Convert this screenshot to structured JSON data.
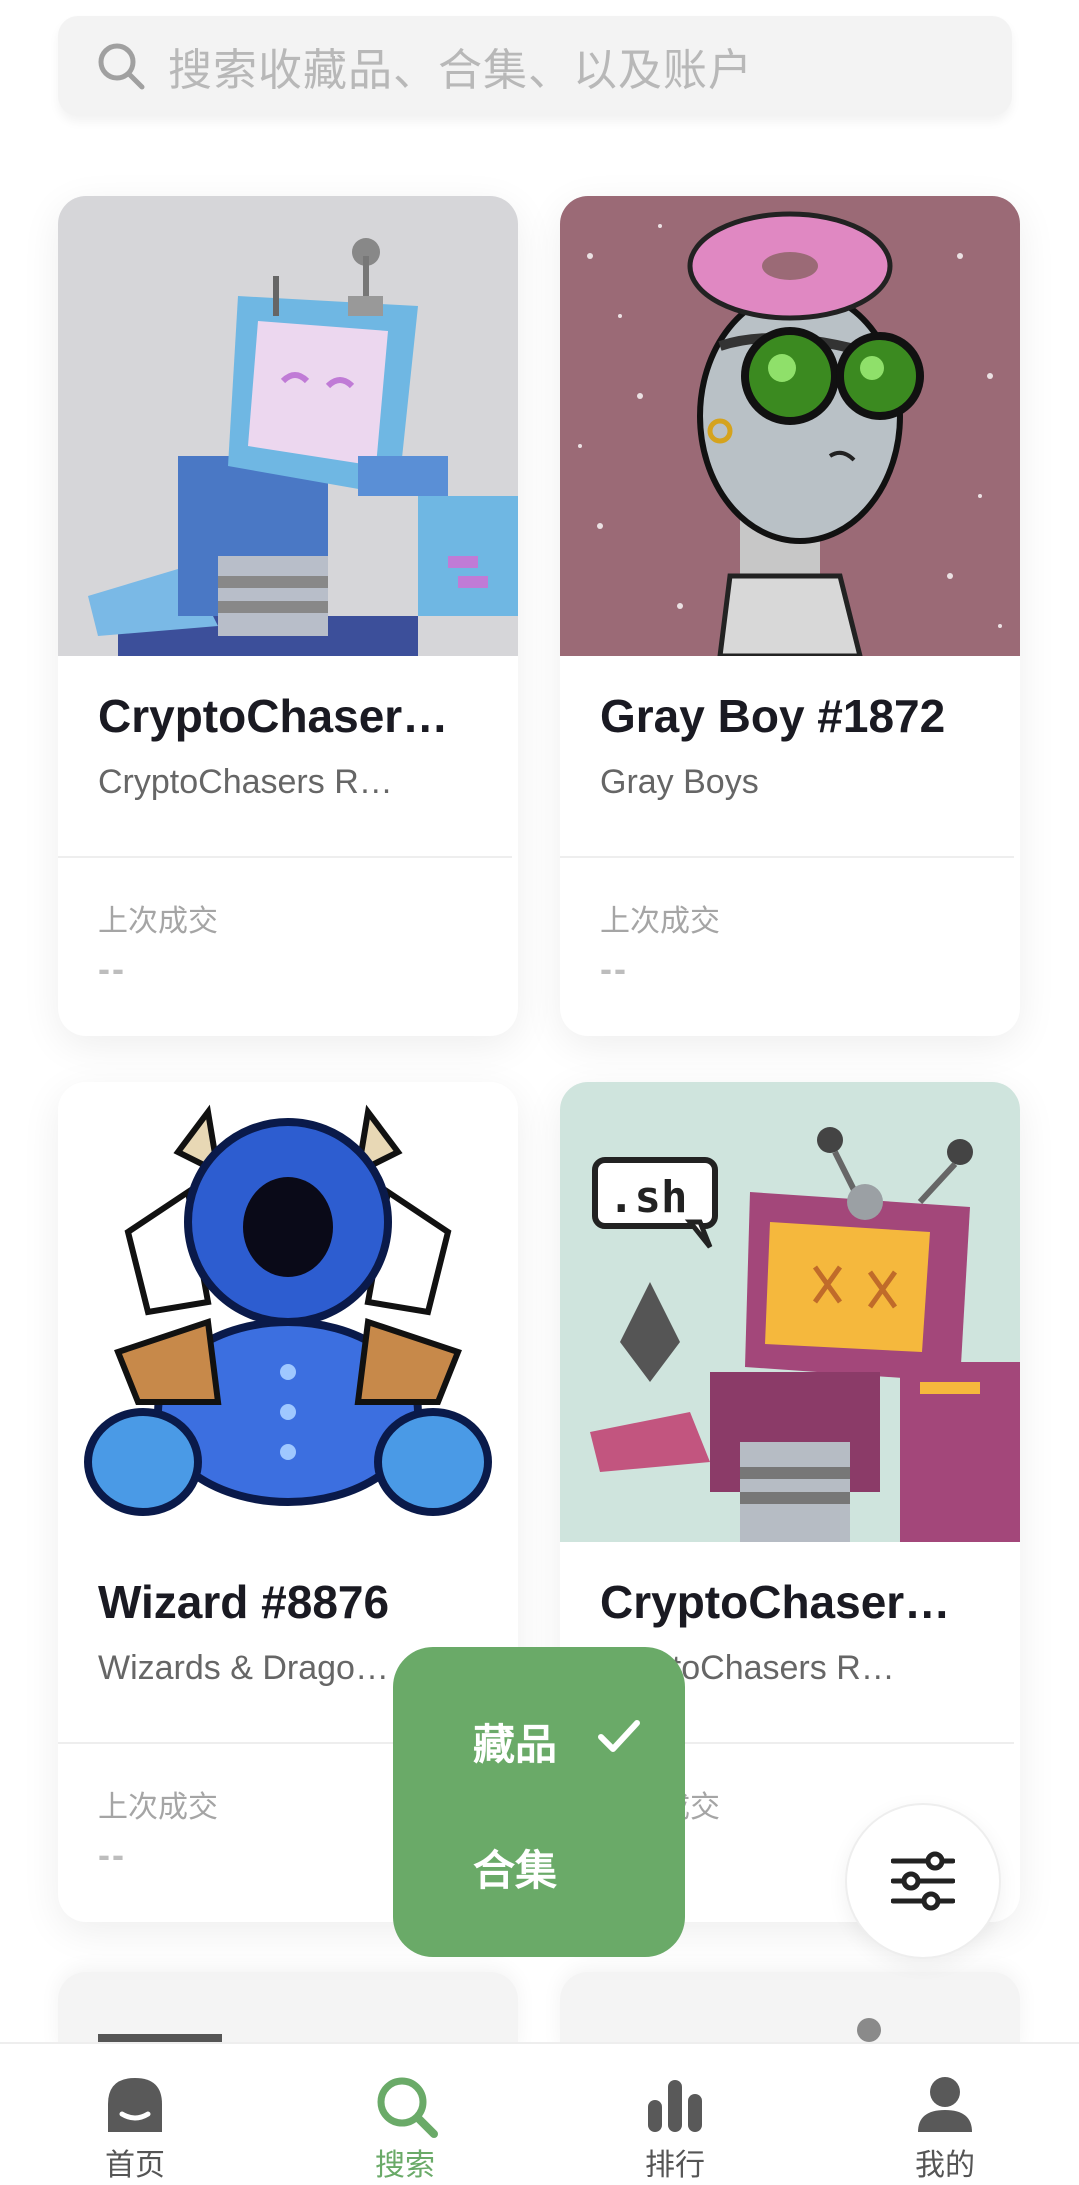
{
  "search": {
    "placeholder": "搜索收藏品、合集、以及账户"
  },
  "cards": [
    {
      "title": "CryptoChaser…",
      "subtitle": "CryptoChasers R…",
      "label": "上次成交",
      "price": "--"
    },
    {
      "title": "Gray Boy #1872",
      "subtitle": "Gray Boys",
      "label": "上次成交",
      "price": "--"
    },
    {
      "title": "Wizard #8876",
      "subtitle": "Wizards & Drago…",
      "label": "上次成交",
      "price": "--"
    },
    {
      "title": "CryptoChaser…",
      "subtitle": "CryptoChasers R…",
      "label": "上次成交",
      "price": "--"
    }
  ],
  "popup": {
    "options": [
      "藏品",
      "合集"
    ],
    "selected": "藏品"
  },
  "nav": {
    "items": [
      {
        "label": "首页",
        "icon": "home-icon"
      },
      {
        "label": "搜索",
        "icon": "search-icon"
      },
      {
        "label": "排行",
        "icon": "ranking-icon"
      },
      {
        "label": "我的",
        "icon": "profile-icon"
      }
    ],
    "active": "搜索"
  },
  "colors": {
    "accent": "#6aaa68",
    "background": "#ffffff"
  }
}
